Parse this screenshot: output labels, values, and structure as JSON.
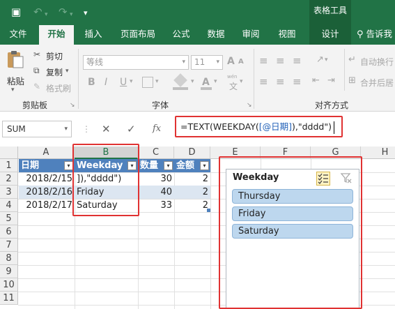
{
  "quick_access": {
    "save_icon": "save-icon",
    "undo_icon": "undo-icon",
    "redo_icon": "redo-icon",
    "customize_icon": "customize-icon",
    "save_glyph": "▣",
    "undo_glyph": "↶",
    "redo_glyph": "↷",
    "customize_glyph": "▾",
    "dropdown_glyph": "▾"
  },
  "contextual_group": "表格工具",
  "tabs": {
    "file": "文件",
    "home": "开始",
    "insert": "插入",
    "page_layout": "页面布局",
    "formulas": "公式",
    "data": "数据",
    "review": "审阅",
    "view": "视图",
    "design": "设计",
    "tell_me": "告诉我"
  },
  "ribbon": {
    "clipboard": {
      "paste": "粘贴",
      "cut": "剪切",
      "copy": "复制",
      "format_painter": "格式刷",
      "group_label": "剪贴板",
      "cut_glyph": "✂",
      "copy_glyph": "⧉",
      "painter_glyph": "✎",
      "dropdown_glyph": "▾"
    },
    "font": {
      "font_name": "等线",
      "font_size": "11",
      "bold": "B",
      "italic": "I",
      "underline": "U",
      "grow": "A",
      "shrink": "A",
      "group_label": "字体",
      "dropdown_glyph": "▾",
      "wen_label": "wén",
      "wen_glyph": "文"
    },
    "alignment": {
      "wrap_text": "自动换行",
      "merge_center": "合并后居",
      "group_label": "对齐方式",
      "align_glyph": "≡",
      "orientation_glyph": "↗",
      "indent_glyph": "⇤",
      "outdent_glyph": "⇥",
      "wrap_glyph": "↵",
      "merge_glyph": "⊞"
    },
    "launcher_glyph": "↘"
  },
  "formula_bar": {
    "name_box": "SUM",
    "cancel": "✕",
    "enter": "✓",
    "fx": "fx",
    "formula_prefix": "=TEXT(WEEKDAY(",
    "formula_ref": "[@日期]",
    "formula_suffix": "),\"dddd\")",
    "dropdown_glyph": "▾",
    "more_glyph": "⋮"
  },
  "grid": {
    "columns": [
      "A",
      "B",
      "C",
      "D",
      "E",
      "F",
      "G",
      "H"
    ],
    "rows": [
      "1",
      "2",
      "3",
      "4",
      "5",
      "6",
      "7",
      "8",
      "9",
      "10",
      "11"
    ],
    "dropdown_glyph": "▾",
    "header_row": [
      "日期",
      "Weekday",
      "数量",
      "金额"
    ],
    "data_rows": [
      [
        "2018/2/15",
        "]),\"dddd\")",
        "30",
        "2"
      ],
      [
        "2018/2/16",
        "Friday",
        "40",
        "2"
      ],
      [
        "2018/2/17",
        "Saturday",
        "33",
        "2"
      ]
    ]
  },
  "slicer": {
    "title": "Weekday",
    "multi_select_icon": "multi-select-icon",
    "clear_filter_icon": "clear-filter-icon",
    "clear_glyph": "✕",
    "items": [
      "Thursday",
      "Friday",
      "Saturday"
    ]
  },
  "colors": {
    "excel_green": "#217346",
    "table_header_blue": "#4f81bd",
    "table_band": "#dce6f1",
    "slicer_item": "#bdd7ee",
    "highlight_red": "#e03232"
  }
}
